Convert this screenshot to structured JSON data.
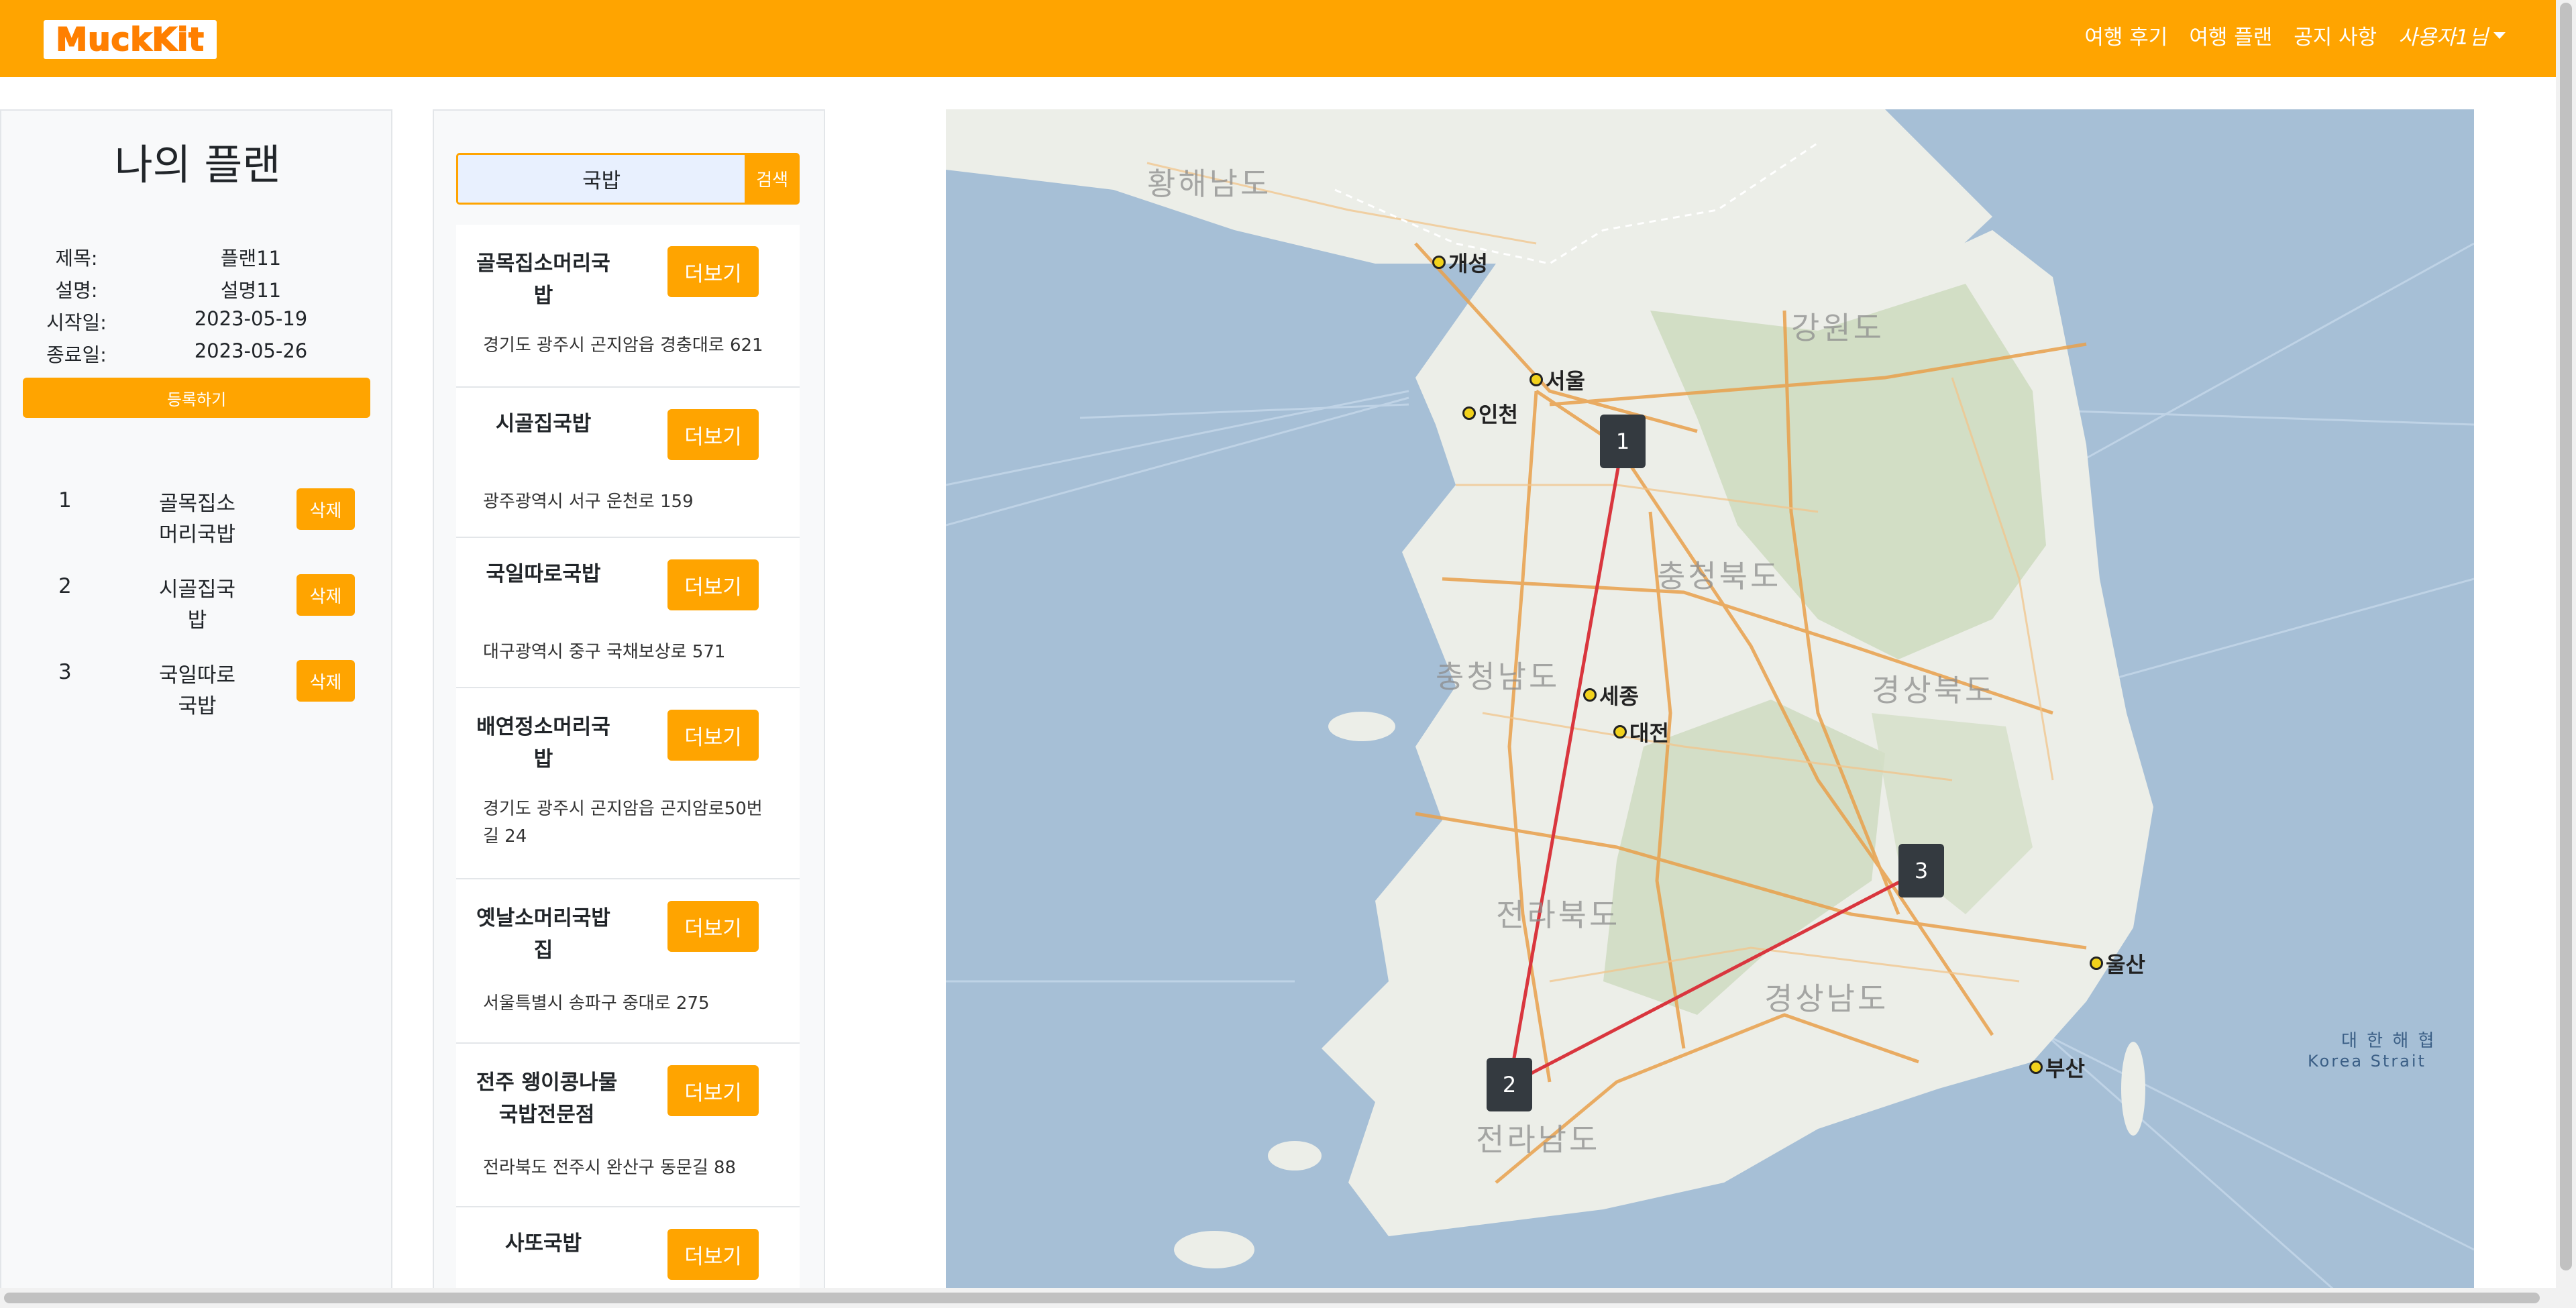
{
  "navbar": {
    "logo": "MuckKit",
    "links": [
      "여행 후기",
      "여행 플랜",
      "공지 사항"
    ],
    "user": "사용자1님"
  },
  "plan": {
    "title": "나의 플랜",
    "fields": [
      {
        "key": "제목:",
        "value": "플랜11"
      },
      {
        "key": "설명:",
        "value": "설명11"
      },
      {
        "key": "시작일:",
        "value": "2023-05-19"
      },
      {
        "key": "종료일:",
        "value": "2023-05-26"
      }
    ],
    "register_label": "등록하기",
    "items": [
      {
        "num": "1",
        "name": "골목집소머리국밥",
        "delete_label": "삭제"
      },
      {
        "num": "2",
        "name": "시골집국밥",
        "delete_label": "삭제"
      },
      {
        "num": "3",
        "name": "국일따로국밥",
        "delete_label": "삭제"
      }
    ]
  },
  "search": {
    "value": "국밥",
    "button_label": "검색",
    "results": [
      {
        "name": "골목집소머리국밥",
        "more_label": "더보기",
        "address": "경기도 광주시 곤지암읍 경충대로 621"
      },
      {
        "name": "시골집국밥",
        "more_label": "더보기",
        "address": "광주광역시 서구 운천로 159"
      },
      {
        "name": "국일따로국밥",
        "more_label": "더보기",
        "address": "대구광역시 중구 국채보상로 571"
      },
      {
        "name": "배연정소머리국밥",
        "more_label": "더보기",
        "address": "경기도 광주시 곤지암읍 곤지암로50번길 24"
      },
      {
        "name": "옛날소머리국밥집",
        "more_label": "더보기",
        "address": "서울특별시 송파구 중대로 275"
      },
      {
        "name": "전주 왱이콩나물국밥전문점",
        "more_label": "더보기",
        "address": "전라북도 전주시 완산구 동문길 88"
      },
      {
        "name": "사또국밥",
        "more_label": "더보기",
        "address": ""
      }
    ]
  },
  "map": {
    "markers": [
      "1",
      "2",
      "3"
    ],
    "route_color": "#d9363e",
    "cities": [
      "개성",
      "서울",
      "인천",
      "세종",
      "대전",
      "울산",
      "부산"
    ],
    "regions": [
      "황해남도",
      "강원도",
      "충청북도",
      "충청남도",
      "경상북도",
      "전라북도",
      "경상남도",
      "전라남도"
    ],
    "sea_labels": [
      "대 한 해 협",
      "Korea Strait"
    ]
  },
  "colors": {
    "accent": "#ffa400",
    "marker": "#343a40"
  }
}
